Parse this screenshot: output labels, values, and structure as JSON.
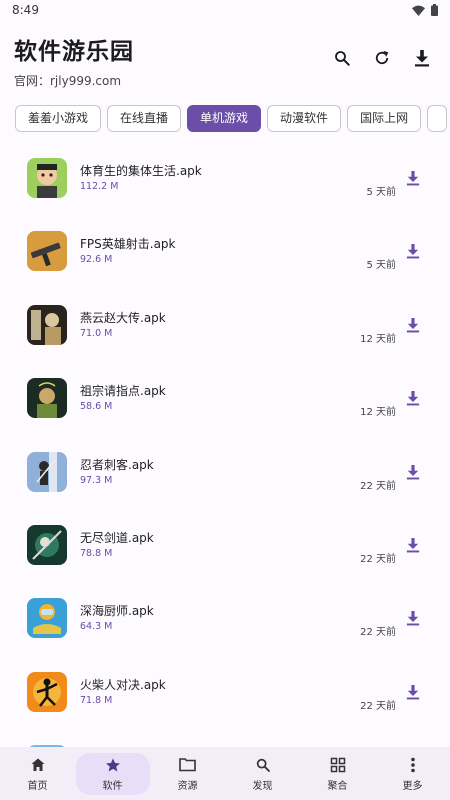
{
  "status_bar": {
    "time": "8:49"
  },
  "header": {
    "title": "软件游乐园",
    "subtitle": "官网：rjly999.com"
  },
  "tabs": [
    {
      "label": "羞羞小游戏",
      "active": false
    },
    {
      "label": "在线直播",
      "active": false
    },
    {
      "label": "单机游戏",
      "active": true
    },
    {
      "label": "动漫软件",
      "active": false
    },
    {
      "label": "国际上网",
      "active": false
    }
  ],
  "items": [
    {
      "name": "体育生的集体生活.apk",
      "size": "112.2 M",
      "time": "5 天前",
      "icon": "cartoon-face-icon"
    },
    {
      "name": "FPS英雄射击.apk",
      "size": "92.6 M",
      "time": "5 天前",
      "icon": "rifle-icon"
    },
    {
      "name": "燕云赵大传.apk",
      "size": "71.0 M",
      "time": "12 天前",
      "icon": "warrior-icon"
    },
    {
      "name": "祖宗请指点.apk",
      "size": "58.6 M",
      "time": "12 天前",
      "icon": "ancestor-icon"
    },
    {
      "name": "忍者刺客.apk",
      "size": "97.3 M",
      "time": "22 天前",
      "icon": "ninja-icon"
    },
    {
      "name": "无尽剑道.apk",
      "size": "78.8 M",
      "time": "22 天前",
      "icon": "sword-icon"
    },
    {
      "name": "深海厨师.apk",
      "size": "64.3 M",
      "time": "22 天前",
      "icon": "diver-icon"
    },
    {
      "name": "火柴人对决.apk",
      "size": "71.8 M",
      "time": "22 天前",
      "icon": "stickman-icon"
    }
  ],
  "bottom_nav": [
    {
      "label": "首页",
      "icon": "home-icon",
      "active": false
    },
    {
      "label": "软件",
      "icon": "star-icon",
      "active": true
    },
    {
      "label": "资源",
      "icon": "folder-icon",
      "active": false
    },
    {
      "label": "发现",
      "icon": "search-icon",
      "active": false
    },
    {
      "label": "聚合",
      "icon": "grid-icon",
      "active": false
    },
    {
      "label": "更多",
      "icon": "more-vertical-icon",
      "active": false
    }
  ],
  "colors": {
    "accent": "#6a4ea8",
    "nav_bg": "#f3edf7",
    "nav_pill": "#e8def8"
  }
}
